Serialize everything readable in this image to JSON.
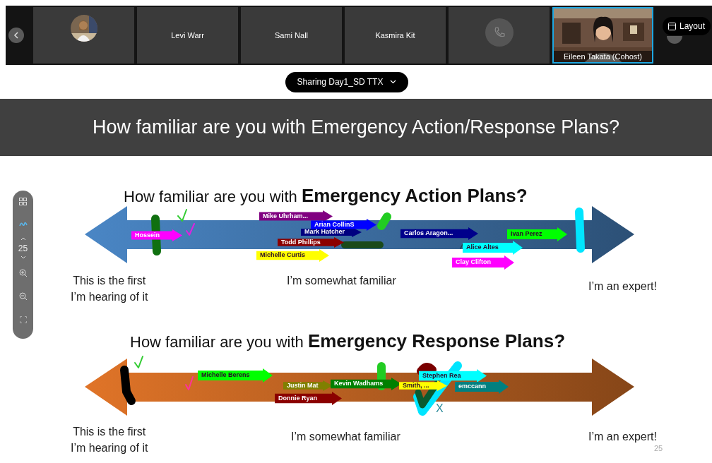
{
  "participants": [
    {
      "kind": "avatar",
      "selected": false
    },
    {
      "kind": "name",
      "name": "Levi Warr",
      "selected": false
    },
    {
      "kind": "name",
      "name": "Sami Nall",
      "selected": false
    },
    {
      "kind": "name",
      "name": "Kasmira Kit",
      "selected": false
    },
    {
      "kind": "phone",
      "selected": false
    },
    {
      "kind": "video",
      "name": "Eileen Takata (Cohost)",
      "selected": true
    }
  ],
  "layout_button": "Layout",
  "share_pill": "Sharing Day1_SD TTX",
  "zoom_toolbar": {
    "page": "25"
  },
  "slide": {
    "title": "How familiar are you with Emergency Action/Response Plans?",
    "charts": [
      {
        "heading": "How familiar are you with **Emergency Action Plans?**",
        "color": "#4a86c5",
        "scale_labels": [
          "This is the first\nI’m hearing of it",
          "I’m somewhat familiar",
          "I’m an expert!"
        ],
        "stickies": [
          {
            "name": "Hossein",
            "color": "#ff00ff"
          },
          {
            "name": "Mike Uhrham...",
            "color": "#800080"
          },
          {
            "name": "Mark Hatcher",
            "color": "#000080"
          },
          {
            "name": "Arian CollinS",
            "color": "#0000ff"
          },
          {
            "name": "Todd Phillips",
            "color": "#8b0000"
          },
          {
            "name": "Michelle Curtis",
            "color": "#ffff00"
          },
          {
            "name": "Carlos Aragon...",
            "color": "#00008b"
          },
          {
            "name": "Ivan Perez",
            "color": "#00ff00"
          },
          {
            "name": "Alice Altes",
            "color": "#00ffff"
          },
          {
            "name": "Clay Clifton",
            "color": "#ff00ff"
          }
        ]
      },
      {
        "heading": "How familiar are you with **Emergency Response Plans?**",
        "color": "#e07428",
        "scale_labels": [
          "This is the first\nI’m hearing of it",
          "I’m somewhat familiar",
          "I’m an expert!"
        ],
        "ink_text": "X",
        "stickies": [
          {
            "name": "Michelle Berens",
            "color": "#00ff00"
          },
          {
            "name": "Justin Mat",
            "color": "#808000"
          },
          {
            "name": "Kevin Wadhams",
            "color": "#008000"
          },
          {
            "name": "Donnie Ryan",
            "color": "#8b0000"
          },
          {
            "name": "Smith, ...",
            "color": "#ffff00"
          },
          {
            "name": "Stephen Rea",
            "color": "#00ffff"
          },
          {
            "name": "emccann",
            "color": "#008080"
          }
        ]
      }
    ],
    "page_number": "25"
  }
}
